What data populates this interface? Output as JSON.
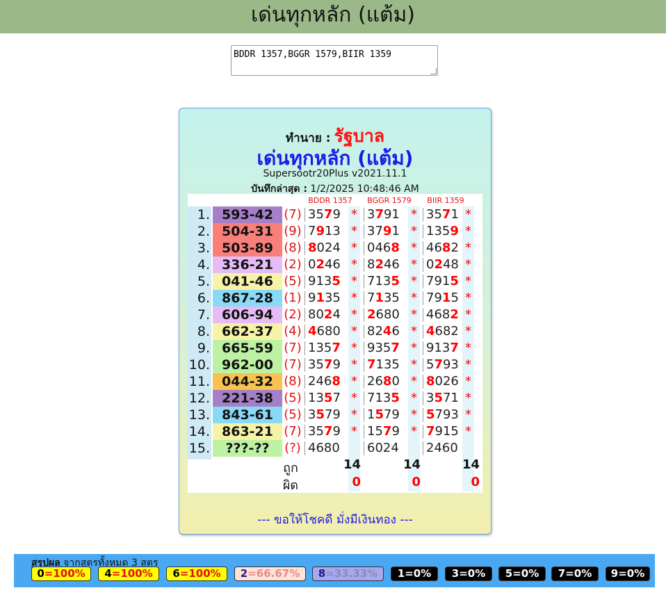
{
  "page": {
    "title": "เด่นทุกหลัก (แต้ม)"
  },
  "formula_input": {
    "value": "BDDR 1357,BGGR 1579,BIIR 1359"
  },
  "card": {
    "pred_label": "ทำนาย :",
    "pred_name": "รัฐบาล",
    "title": "เด่นทุกหลัก (แต้ม)",
    "version": "Supersootr20Plus v2021.11.1",
    "saved_label": "บันทึกล่าสุด :",
    "saved_time": "1/2/2025 10:48:46 AM",
    "footer": "--- ขอให้โชคดี มั่งมีเงินทอง ---"
  },
  "table": {
    "columns": [
      "BDDR 1357",
      "BGGR 1579",
      "BIIR 1359"
    ],
    "rows": [
      {
        "idx": "1.",
        "result": "593-42",
        "par": "(7)",
        "color": "#a57fc7",
        "cells": [
          [
            "35",
            "7",
            "9"
          ],
          [
            "3",
            "7",
            "91"
          ],
          [
            "35",
            "7",
            "1"
          ]
        ],
        "stars": [
          "*",
          "*",
          "*"
        ]
      },
      {
        "idx": "2.",
        "result": "504-31",
        "par": "(9)",
        "color": "#f9807a",
        "cells": [
          [
            "7",
            "9",
            "13"
          ],
          [
            "37",
            "9",
            "1"
          ],
          [
            "135",
            "9",
            ""
          ]
        ],
        "stars": [
          "*",
          "*",
          "*"
        ]
      },
      {
        "idx": "3.",
        "result": "503-89",
        "par": "(8)",
        "color": "#f9807a",
        "cells": [
          [
            "",
            "8",
            "024"
          ],
          [
            "046",
            "8",
            ""
          ],
          [
            "46",
            "8",
            "2"
          ]
        ],
        "stars": [
          "*",
          "*",
          "*"
        ]
      },
      {
        "idx": "4.",
        "result": "336-21",
        "par": "(2)",
        "color": "#e6bcf7",
        "cells": [
          [
            "0",
            "2",
            "46"
          ],
          [
            "8",
            "2",
            "46"
          ],
          [
            "0",
            "2",
            "48"
          ]
        ],
        "stars": [
          "*",
          "*",
          "*"
        ]
      },
      {
        "idx": "5.",
        "result": "041-46",
        "par": "(5)",
        "color": "#f6f3a6",
        "cells": [
          [
            "913",
            "5",
            ""
          ],
          [
            "713",
            "5",
            ""
          ],
          [
            "791",
            "5",
            ""
          ]
        ],
        "stars": [
          "*",
          "*",
          "*"
        ]
      },
      {
        "idx": "6.",
        "result": "867-28",
        "par": "(1)",
        "color": "#8ad9f6",
        "cells": [
          [
            "9",
            "1",
            "35"
          ],
          [
            "7",
            "1",
            "35"
          ],
          [
            "79",
            "1",
            "5"
          ]
        ],
        "stars": [
          "*",
          "*",
          "*"
        ]
      },
      {
        "idx": "7.",
        "result": "606-94",
        "par": "(2)",
        "color": "#e6bcf7",
        "cells": [
          [
            "80",
            "2",
            "4"
          ],
          [
            "",
            "2",
            "680"
          ],
          [
            "468",
            "2",
            ""
          ]
        ],
        "stars": [
          "*",
          "*",
          "*"
        ]
      },
      {
        "idx": "8.",
        "result": "662-37",
        "par": "(4)",
        "color": "#f6f3a6",
        "cells": [
          [
            "",
            "4",
            "680"
          ],
          [
            "82",
            "4",
            "6"
          ],
          [
            "",
            "4",
            "682"
          ]
        ],
        "stars": [
          "*",
          "*",
          "*"
        ]
      },
      {
        "idx": "9.",
        "result": "665-59",
        "par": "(7)",
        "color": "#bdf1a3",
        "cells": [
          [
            "135",
            "7",
            ""
          ],
          [
            "935",
            "7",
            ""
          ],
          [
            "913",
            "7",
            ""
          ]
        ],
        "stars": [
          "*",
          "*",
          "*"
        ]
      },
      {
        "idx": "10.",
        "result": "962-00",
        "par": "(7)",
        "color": "#bdf1a3",
        "cells": [
          [
            "35",
            "7",
            "9"
          ],
          [
            "",
            "7",
            "135"
          ],
          [
            "5",
            "7",
            "93"
          ]
        ],
        "stars": [
          "*",
          "*",
          "*"
        ]
      },
      {
        "idx": "11.",
        "result": "044-32",
        "par": "(8)",
        "color": "#f7c24f",
        "cells": [
          [
            "246",
            "8",
            ""
          ],
          [
            "26",
            "8",
            "0"
          ],
          [
            "",
            "8",
            "026"
          ]
        ],
        "stars": [
          "*",
          "*",
          "*"
        ]
      },
      {
        "idx": "12.",
        "result": "221-38",
        "par": "(5)",
        "color": "#a57fc7",
        "cells": [
          [
            "13",
            "5",
            "7"
          ],
          [
            "713",
            "5",
            ""
          ],
          [
            "3",
            "5",
            "71"
          ]
        ],
        "stars": [
          "*",
          "*",
          "*"
        ]
      },
      {
        "idx": "13.",
        "result": "843-61",
        "par": "(5)",
        "color": "#8ad9f6",
        "cells": [
          [
            "3",
            "5",
            "79"
          ],
          [
            "1",
            "5",
            "79"
          ],
          [
            "",
            "5",
            "793"
          ]
        ],
        "stars": [
          "*",
          "*",
          "*"
        ]
      },
      {
        "idx": "14.",
        "result": "863-21",
        "par": "(7)",
        "color": "#f6f3a6",
        "cells": [
          [
            "35",
            "7",
            "9"
          ],
          [
            "15",
            "7",
            "9"
          ],
          [
            "",
            "7",
            "915"
          ]
        ],
        "stars": [
          "*",
          "*",
          "*"
        ]
      },
      {
        "idx": "15.",
        "result": "???-??",
        "par": "(?)",
        "color": "#bdf1a3",
        "cells": [
          [
            "4680",
            "",
            ""
          ],
          [
            "6024",
            "",
            ""
          ],
          [
            "2460",
            "",
            ""
          ]
        ],
        "stars": [
          "",
          "",
          ""
        ]
      }
    ],
    "correct_label": "ถูก",
    "wrong_label": "ผิด",
    "correct": [
      "14",
      "14",
      "14"
    ],
    "wrong": [
      "0",
      "0",
      "0"
    ]
  },
  "summary": {
    "title_bold": "สรุปผล",
    "title_rest": " จากสูตรทั้งหมด 3 สูตร",
    "items": [
      {
        "digit": "0",
        "pct": "=100%",
        "bg": "#ffff00",
        "digit_color": "#000000",
        "pct_color": "#e01010"
      },
      {
        "digit": "4",
        "pct": "=100%",
        "bg": "#ffff00",
        "digit_color": "#000000",
        "pct_color": "#e01010"
      },
      {
        "digit": "6",
        "pct": "=100%",
        "bg": "#ffff00",
        "digit_color": "#000000",
        "pct_color": "#e01010"
      },
      {
        "digit": "2",
        "pct": "=66.67%",
        "bg": "#fde3d8",
        "digit_color": "#1a1a8a",
        "pct_color": "#e88a8a"
      },
      {
        "digit": "8",
        "pct": "=33.33%",
        "bg": "#a8a8f0",
        "digit_color": "#1a1a8a",
        "pct_color": "#8a8ab8"
      },
      {
        "digit": "1",
        "pct": "=0%",
        "bg": "#000000",
        "digit_color": "#ffffff",
        "pct_color": "#ffffff"
      },
      {
        "digit": "3",
        "pct": "=0%",
        "bg": "#000000",
        "digit_color": "#ffffff",
        "pct_color": "#ffffff"
      },
      {
        "digit": "5",
        "pct": "=0%",
        "bg": "#000000",
        "digit_color": "#ffffff",
        "pct_color": "#ffffff"
      },
      {
        "digit": "7",
        "pct": "=0%",
        "bg": "#000000",
        "digit_color": "#ffffff",
        "pct_color": "#ffffff"
      },
      {
        "digit": "9",
        "pct": "=0%",
        "bg": "#000000",
        "digit_color": "#ffffff",
        "pct_color": "#ffffff"
      }
    ]
  }
}
